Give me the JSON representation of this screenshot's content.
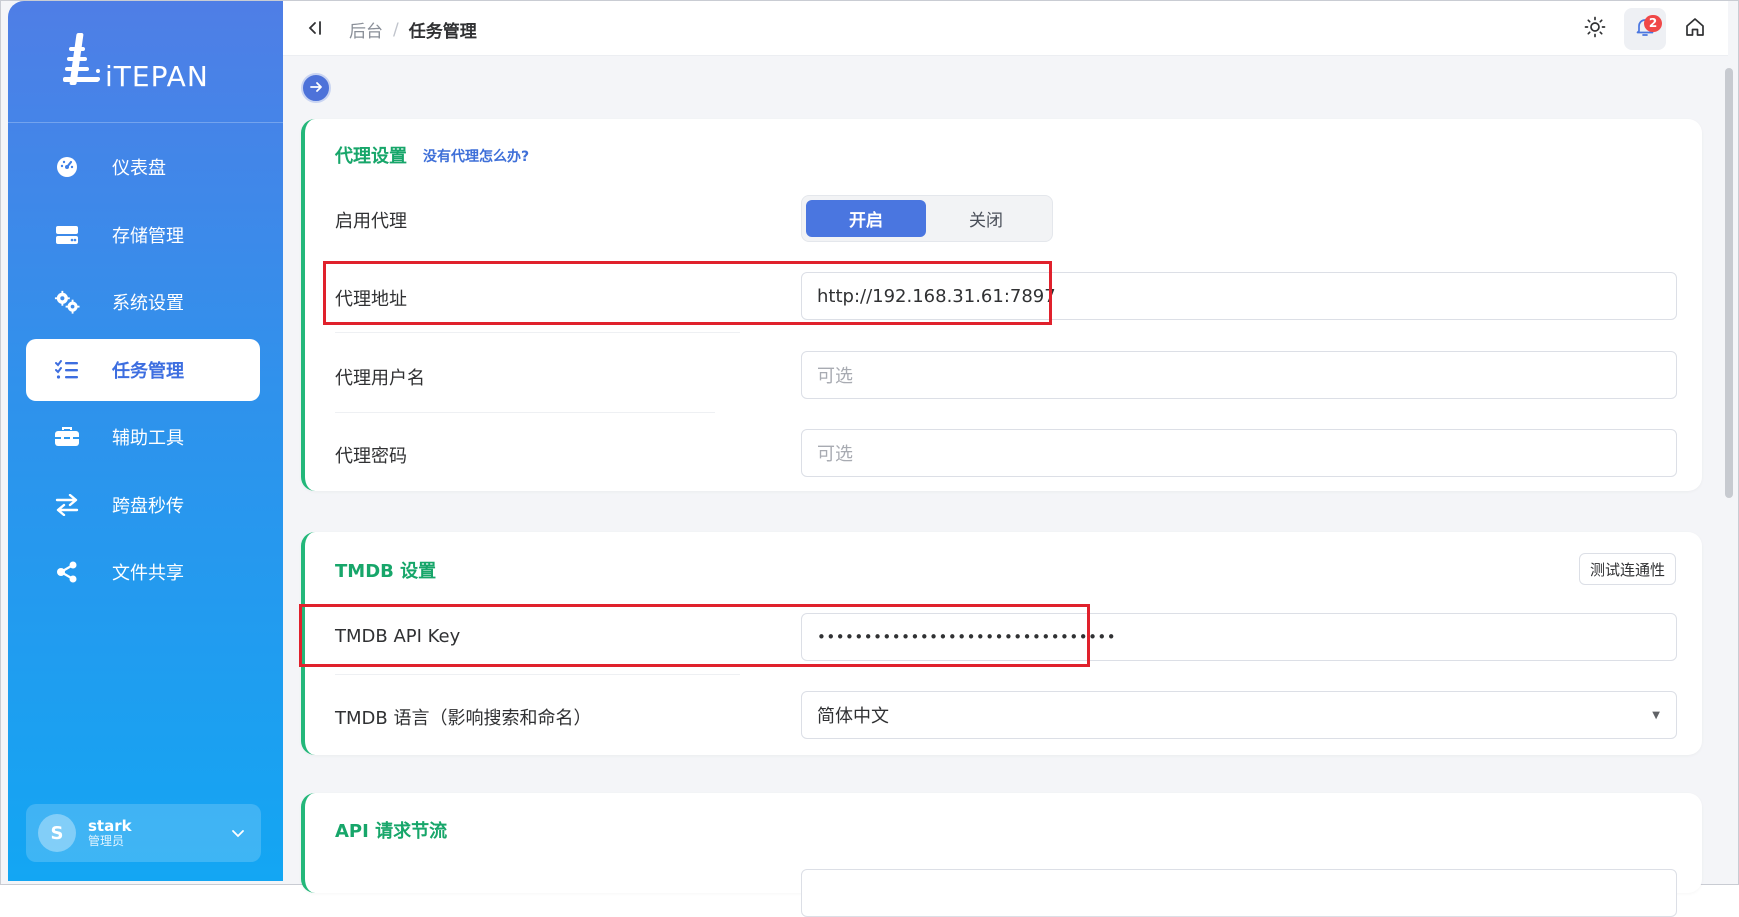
{
  "app": {
    "logo_text": "iTEPAN"
  },
  "sidebar": {
    "items": [
      {
        "label": "仪表盘",
        "icon": "dashboard-gauge-icon"
      },
      {
        "label": "存储管理",
        "icon": "storage-drive-icon"
      },
      {
        "label": "系统设置",
        "icon": "gears-icon"
      },
      {
        "label": "任务管理",
        "icon": "task-list-icon",
        "active": true
      },
      {
        "label": "辅助工具",
        "icon": "toolbox-icon"
      },
      {
        "label": "跨盘秒传",
        "icon": "transfer-arrows-icon"
      },
      {
        "label": "文件共享",
        "icon": "share-nodes-icon"
      }
    ],
    "user": {
      "initial": "S",
      "name": "stark",
      "role": "管理员"
    }
  },
  "header": {
    "breadcrumb_root": "后台",
    "breadcrumb_sep": "/",
    "breadcrumb_current": "任务管理",
    "notification_count": "2"
  },
  "proxy": {
    "title": "代理设置",
    "help_link": "没有代理怎么办?",
    "enable_label": "启用代理",
    "toggle_on": "开启",
    "toggle_off": "关闭",
    "toggle_state": "开启",
    "address_label": "代理地址",
    "address_value": "http://192.168.31.61:7897",
    "username_label": "代理用户名",
    "username_placeholder": "可选",
    "password_label": "代理密码",
    "password_placeholder": "可选"
  },
  "tmdb": {
    "title": "TMDB 设置",
    "test_button": "测试连通性",
    "api_key_label": "TMDB API Key",
    "api_key_value": "••••••••••••••••••••••••••••••••",
    "language_label": "TMDB 语言（影响搜索和命名）",
    "language_value": "简体中文"
  },
  "api_throttle": {
    "title": "API 请求节流"
  },
  "colors": {
    "accent": "#4a76e0",
    "section_title": "#17a66a",
    "highlight_box": "#e0212c",
    "sidebar_top": "#4f7ee6",
    "sidebar_bottom": "#13a6f3"
  }
}
